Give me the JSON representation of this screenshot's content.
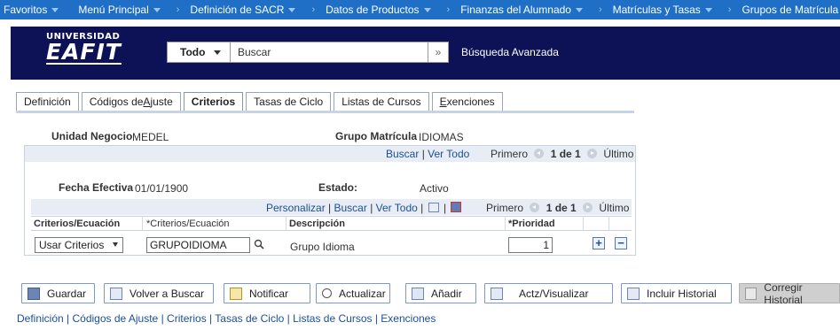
{
  "topnav": {
    "items": [
      "Favoritos",
      "Menú Principal"
    ],
    "breadcrumbs": [
      "Definición de SACR",
      "Datos de Productos",
      "Finanzas del Alumnado",
      "Matrículas y Tasas",
      "Grupos de Matrícula"
    ]
  },
  "header": {
    "logo_top": "UNIVERSIDAD",
    "logo_main": "EAFIT",
    "search_scope": "Todo",
    "search_placeholder": "Buscar",
    "advanced_search": "Búsqueda Avanzada"
  },
  "tabs": [
    {
      "label": "Definición"
    },
    {
      "label_pre": "Códigos de ",
      "label_u": "A",
      "label_post": "juste"
    },
    {
      "label": "Criterios",
      "active": true
    },
    {
      "label": "Tasas de Ciclo"
    },
    {
      "label": "Listas de Cursos"
    },
    {
      "label_u": "E",
      "label_post": "xenciones"
    }
  ],
  "form": {
    "unidad_negocio_label": "Unidad Negocio",
    "unidad_negocio_value": "MEDEL",
    "grupo_matricula_label": "Grupo Matrícula",
    "grupo_matricula_value": "IDIOMAS"
  },
  "outer_nav": {
    "buscar": "Buscar",
    "ver_todo": "Ver Todo",
    "primero": "Primero",
    "count": "1 de 1",
    "ultimo": "Último"
  },
  "effective": {
    "fecha_label": "Fecha Efectiva",
    "fecha_value": "01/01/1900",
    "estado_label": "Estado:",
    "estado_value": "Activo"
  },
  "grid_nav": {
    "personalizar": "Personalizar",
    "buscar": "Buscar",
    "ver_todo": "Ver Todo",
    "primero": "Primero",
    "count": "1 de 1",
    "ultimo": "Último"
  },
  "grid": {
    "headers": [
      "Criterios/Ecuación",
      "*Criterios/Ecuación",
      "Descripción",
      "*Prioridad"
    ],
    "row": {
      "tipo": "Usar Criterios",
      "codigo": "GRUPOIDIOMA",
      "descripcion": "Grupo Idioma",
      "prioridad": "1"
    }
  },
  "buttons": {
    "guardar": "Guardar",
    "volver": "Volver a Buscar",
    "notificar": "Notificar",
    "actualizar": "Actualizar",
    "anadir": "Añadir",
    "actz": "Actz/Visualizar",
    "incluir": "Incluir Historial",
    "corregir": "Corregir Historial"
  },
  "footer_links": [
    "Definición",
    "Códigos de Ajuste",
    "Criterios",
    "Tasas de Ciclo",
    "Listas de Cursos",
    "Exenciones"
  ],
  "colors": {
    "topnav_bg": "#1f6fc6",
    "header_bg": "#0c1255",
    "link": "#1a4f97"
  }
}
